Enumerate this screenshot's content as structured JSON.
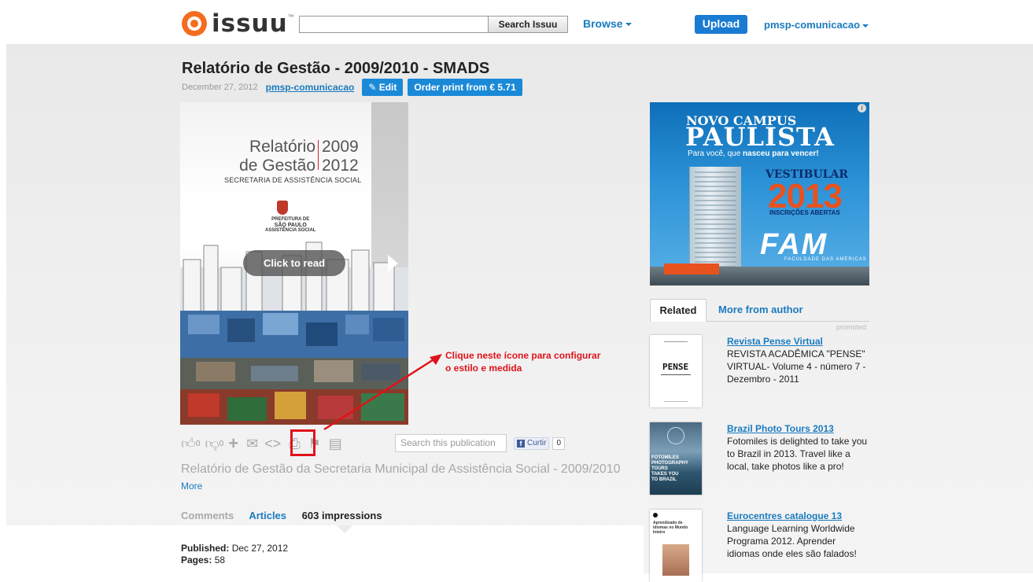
{
  "header": {
    "logo_text": "issuu",
    "logo_tm": "™",
    "search_placeholder": "",
    "search_button": "Search Issuu",
    "browse_label": "Browse",
    "upload_label": "Upload",
    "user_label": "pmsp-comunicacao"
  },
  "document": {
    "title": "Relatório de Gestão - 2009/2010 - SMADS",
    "date": "December 27, 2012",
    "author": "pmsp-comunicacao",
    "edit_label": "Edit",
    "order_label": "Order print from € 5.71",
    "cover": {
      "line1a": "Relatório",
      "line1b": "de Gestão",
      "year1": "2009",
      "year2": "2012",
      "subtitle": "SECRETARIA DE ASSISTÊNCIA SOCIAL",
      "pref1": "PREFEITURA DE",
      "pref2": "SÃO PAULO",
      "pref3": "ASSISTÊNCIA SOCIAL",
      "click_to_read": "Click to read"
    },
    "description": "Relatório de Gestão da Secretaria Municipal de Assistência Social - 2009/2010",
    "more_label": "More"
  },
  "annotation": {
    "line1": "Clique neste ícone para configurar",
    "line2": "o estilo e medida"
  },
  "actions": {
    "like_count": "0",
    "dislike_count": "0",
    "search_placeholder": "Search this publication",
    "fb_like": "Curtir",
    "fb_count": "0"
  },
  "tabs": {
    "comments": "Comments",
    "articles": "Articles",
    "impressions": "603 impressions"
  },
  "details": {
    "published_label": "Published:",
    "published_value": "Dec 27, 2012",
    "pages_label": "Pages:",
    "pages_value": "58"
  },
  "ad": {
    "info": "i",
    "novo_campus": "NOVO CAMPUS",
    "paulista": "PAULISTA",
    "tag_prefix": "Para você, que ",
    "tag_bold": "nasceu para vencer!",
    "vestibular": "VESTIBULAR",
    "year": "2013",
    "inscricoes": "INSCRIÇÕES ABERTAS",
    "brand": "FAM",
    "brand_sub": "FACULDADE DAS AMÉRICAS"
  },
  "related": {
    "tab_related": "Related",
    "tab_more": "More from author",
    "promoted": "promoted",
    "items": [
      {
        "title": "Revista Pense Virtual",
        "desc": "REVISTA ACADÊMICA \"PENSE\" VIRTUAL- Volume 4 - número 7 - Dezembro - 2011",
        "thumb_text": "PENSE"
      },
      {
        "title": "Brazil Photo Tours 2013",
        "desc": "Fotomiles is delighted to take you to Brazil in 2013. Travel like a local, take photos like a pro!",
        "thumb_text": "FOTOMILES PHOTOGRAPHY TOURS TAKES YOU TO BRAZIL"
      },
      {
        "title": "Eurocentres catalogue 13",
        "desc": "Language Learning Worldwide Programa 2012. Aprender idiomas onde eles são falados!",
        "thumb_text": "Aprendizado de idiomas no Mundo Inteiro"
      }
    ]
  },
  "colors": {
    "brand_orange": "#f36d21",
    "link_blue": "#1a7bbf",
    "button_blue": "#1a8ad8",
    "annotation_red": "#e0131a"
  }
}
